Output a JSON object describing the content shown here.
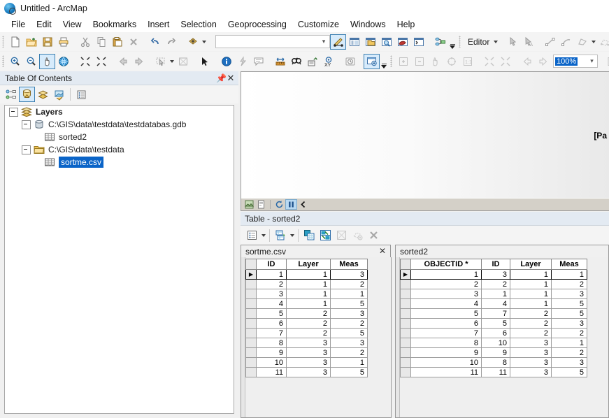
{
  "window": {
    "title": "Untitled - ArcMap",
    "app_icon": "arcmap-globe-icon"
  },
  "menubar": {
    "items": [
      "File",
      "Edit",
      "View",
      "Bookmarks",
      "Insert",
      "Selection",
      "Geoprocessing",
      "Customize",
      "Windows",
      "Help"
    ]
  },
  "standard_toolbar": {
    "buttons": [
      "new-document",
      "open-document",
      "save-document",
      "print",
      "cut",
      "copy",
      "paste",
      "delete",
      "undo",
      "redo",
      "add-data"
    ],
    "combo_value": "",
    "right_buttons": [
      "editor-toolbar-toggle",
      "table-of-contents",
      "catalog-window",
      "search-window",
      "arctoolbox",
      "python-window",
      "modelbuilder"
    ]
  },
  "editor_toolbar": {
    "label": "Editor",
    "buttons": [
      "edit-tool",
      "edit-annotation-tool",
      "straight-segment",
      "end-point-arc",
      "trace",
      "edit-vertices",
      "reshape-feature"
    ]
  },
  "tools_toolbar": {
    "buttons": [
      "zoom-in",
      "zoom-out",
      "pan",
      "full-extent",
      "fixed-zoom-in",
      "fixed-zoom-out",
      "go-back-extent",
      "go-forward-extent",
      "select-features",
      "select-elements",
      "pointer",
      "identify",
      "hyperlink",
      "html-popup",
      "measure",
      "find",
      "find-route",
      "go-to-xy",
      "time-slider",
      "create-viewer-window"
    ],
    "selected": "pan"
  },
  "layout_toolbar": {
    "buttons": [
      "zoom-in-page",
      "zoom-out-page",
      "pan-page",
      "zoom-whole-page",
      "zoom-100",
      "zoom-to-last-extent",
      "zoom-to-next-extent",
      "go-back-layout",
      "go-forward-layout"
    ],
    "zoom_value": "100%"
  },
  "toc": {
    "title": "Table Of Contents",
    "pin_icon": "pin-icon",
    "close_icon": "close-icon",
    "tool_buttons": [
      "list-by-drawing-order",
      "list-by-source",
      "list-by-visibility",
      "list-by-selection",
      "toc-options"
    ],
    "selected_tool": "list-by-source",
    "tree": [
      {
        "label": "Layers",
        "icon": "layers-icon",
        "indent": 0,
        "expandable": true,
        "bold": true,
        "selected": false
      },
      {
        "label": "C:\\GIS\\data\\testdata\\testdatabas.gdb",
        "icon": "geodatabase-icon",
        "indent": 1,
        "expandable": true,
        "bold": false,
        "selected": false
      },
      {
        "label": "sorted2",
        "icon": "table-icon",
        "indent": 2,
        "expandable": false,
        "bold": false,
        "selected": false
      },
      {
        "label": "C:\\GIS\\data\\testdata",
        "icon": "folder-icon",
        "indent": 1,
        "expandable": true,
        "bold": false,
        "selected": false
      },
      {
        "label": "sortme.csv",
        "icon": "table-icon",
        "indent": 2,
        "expandable": false,
        "bold": false,
        "selected": true
      }
    ]
  },
  "map_view": {
    "overlay_text": "[Pa",
    "status_buttons": [
      "data-view",
      "layout-view",
      "refresh-view",
      "pause-drawing",
      "collapse-panel"
    ],
    "paused_active": true
  },
  "table_window": {
    "title": "Table - sorted2",
    "tool_buttons": [
      "table-options",
      "related-tables",
      "select-by-attributes",
      "switch-selection",
      "clear-selection",
      "zoom-to-selected",
      "delete-selected"
    ],
    "tabs": [
      {
        "label": "sortme.csv",
        "active": true,
        "closable": true
      },
      {
        "label": "sorted2",
        "active": false,
        "closable": false
      }
    ],
    "left_table": {
      "name": "sortme.csv",
      "columns": [
        "ID",
        "Layer",
        "Meas"
      ],
      "rows": [
        [
          "1",
          "1",
          "3"
        ],
        [
          "2",
          "1",
          "2"
        ],
        [
          "3",
          "1",
          "1"
        ],
        [
          "4",
          "1",
          "5"
        ],
        [
          "5",
          "2",
          "3"
        ],
        [
          "6",
          "2",
          "2"
        ],
        [
          "7",
          "2",
          "5"
        ],
        [
          "8",
          "3",
          "3"
        ],
        [
          "9",
          "3",
          "2"
        ],
        [
          "10",
          "3",
          "1"
        ],
        [
          "11",
          "3",
          "5"
        ]
      ],
      "current_row": 1
    },
    "right_table": {
      "name": "sorted2",
      "columns": [
        "OBJECTID *",
        "ID",
        "Layer",
        "Meas"
      ],
      "rows": [
        [
          "1",
          "3",
          "1",
          "1"
        ],
        [
          "2",
          "2",
          "1",
          "2"
        ],
        [
          "3",
          "1",
          "1",
          "3"
        ],
        [
          "4",
          "4",
          "1",
          "5"
        ],
        [
          "5",
          "7",
          "2",
          "5"
        ],
        [
          "6",
          "5",
          "2",
          "3"
        ],
        [
          "7",
          "6",
          "2",
          "2"
        ],
        [
          "8",
          "10",
          "3",
          "1"
        ],
        [
          "9",
          "9",
          "3",
          "2"
        ],
        [
          "10",
          "8",
          "3",
          "3"
        ],
        [
          "11",
          "11",
          "3",
          "5"
        ]
      ],
      "current_row": 1
    }
  },
  "colors": {
    "selection_blue": "#0a64c8",
    "toolbar_bg": "#f4f4f4",
    "panel_header": "#e3eaf2",
    "status_bar": "#d4d0c8"
  }
}
